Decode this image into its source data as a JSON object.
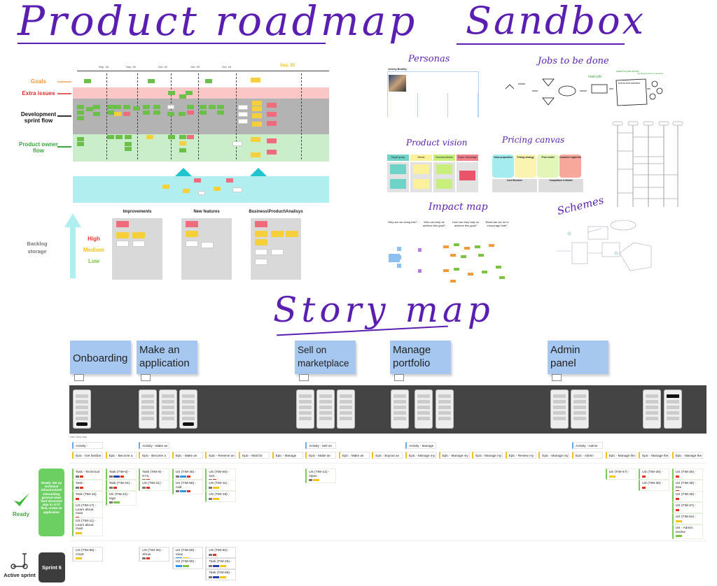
{
  "titles": {
    "roadmap": "Product roadmap",
    "sandbox": "Sandbox",
    "story_map": "Story map"
  },
  "roadmap": {
    "dates": [
      "Sep. 18",
      "Sep. 25",
      "Oct. 02",
      "Oct. 09",
      "Oct. 16",
      "Sep. 25"
    ],
    "highlight_color": "#f5c518",
    "rows": {
      "goals": {
        "label": "Goals",
        "color": "#f39a3a"
      },
      "extra": {
        "label": "Extra issues",
        "color": "#e02a2a"
      },
      "dev": {
        "label": "Development sprint flow",
        "color": "#111111"
      },
      "po": {
        "label": "Product owner flow",
        "color": "#3aa53a"
      }
    },
    "band_colors": {
      "extra": "#fbc6c6",
      "dev": "#b3b3b3",
      "po": "#c9eec9",
      "backlog": "#b1eef0"
    },
    "backlog": {
      "label": "Backlog storage",
      "priorities": [
        {
          "label": "High",
          "color": "#e53333"
        },
        {
          "label": "Medium",
          "color": "#f3c21b"
        },
        {
          "label": "Low",
          "color": "#7dc243"
        }
      ],
      "columns": [
        "Improvements",
        "New features",
        "Business\\Product\\Analisys"
      ]
    }
  },
  "sandbox": {
    "sections": [
      "Personas",
      "Jobs to be done",
      "Product vision",
      "Pricing canvas",
      "Impact map",
      "Schemes"
    ],
    "persona_name": "Jeremy Bradley",
    "jtbd_notes": [
      "main job",
      "end-to-end scenario",
      "assist for jobs stories",
      "hypothesis about motivation"
    ],
    "vision_headers": [
      "Target group",
      "Needs",
      "Success factors",
      "Super advantage"
    ],
    "pricing_blocks": [
      "Value proposition",
      "Pricing strategy",
      "Price model",
      "Customer segments",
      "Cost Structure",
      "Competitors & Market"
    ],
    "impact_questions": [
      "Why are we doing this?",
      "Who can help us achieve this goal?",
      "How can they help us achieve this goal?",
      "What can we do to encourage that?"
    ]
  },
  "story_map": {
    "activities": [
      "Onboarding",
      "Make an application",
      "Sell on marketplace",
      "Manage portfolio",
      "Admin panel"
    ],
    "caption": "User Story Map",
    "activity_cards": [
      {
        "col": 0,
        "label": "Activity -"
      },
      {
        "col": 2,
        "label": "Activity - Make an"
      },
      {
        "col": 7,
        "label": "Activity - Sell on"
      },
      {
        "col": 10,
        "label": "Activity - Manage"
      },
      {
        "col": 15,
        "label": "Activity - Admin"
      }
    ],
    "epics": [
      "Epic - Get familiar",
      "Epic - Become a",
      "Epic - Become a",
      "Epic - Make an",
      "Epic - Reserve an",
      "Epic - Wait for",
      "Epic - Manage",
      "Epic - Make an",
      "Epic - Make an",
      "Epic - Buyout an",
      "Epic - Manage my",
      "Epic - Manage my",
      "Epic - Manage my",
      "Epic - Review my",
      "Epic - Manage my",
      "Epic - Admin",
      "Epic - Manage the",
      "Epic - Manage the",
      "Epic - Manage the"
    ],
    "ready": {
      "label": "Ready",
      "description": "Ready: Set up technical infrastructure/ onboarding, general news feed structure/ sign in, KYC flow, create an application",
      "color": "#6ccf62",
      "cards": [
        {
          "col": 0,
          "items": [
            {
              "t": "Task - Technical",
              "tags": [
                "g",
                "r"
              ]
            },
            {
              "t": "Task -",
              "tags": [
                "g",
                "r"
              ]
            },
            {
              "t": "Task (TIM-15)",
              "tags": [
                "r"
              ]
            },
            {
              "t": "US (TIM-17) - Learn about main",
              "tags": [
                "r"
              ]
            },
            {
              "t": "US (TIM-11) - Learn about main",
              "tags": [
                "y"
              ]
            }
          ]
        },
        {
          "col": 1,
          "items": [
            {
              "t": "Task (TIM-6) -",
              "tags": [
                "g",
                "b",
                "r"
              ]
            },
            {
              "t": "Task (TIM-24) -",
              "tags": [
                "g",
                "r"
              ]
            },
            {
              "t": "US (TIM-22) - Sign",
              "tags": [
                "g",
                "gr"
              ]
            }
          ]
        },
        {
          "col": 2,
          "items": [
            {
              "t": "Task (TIM-9) - KYC",
              "tags": [
                "g",
                "r"
              ]
            },
            {
              "t": "US (TIM-21) -",
              "tags": [
                "g",
                "r"
              ]
            }
          ]
        },
        {
          "col": 3,
          "items": [
            {
              "t": "US (TIM-46) -",
              "tags": [
                "g",
                "l",
                "r"
              ]
            },
            {
              "t": "US (TIM-58) - Add",
              "tags": [
                "g",
                "l",
                "r"
              ]
            }
          ]
        },
        {
          "col": 4,
          "items": [
            {
              "t": "US (TIM-50) - Get",
              "tags": [
                "g",
                "r"
              ]
            },
            {
              "t": "US (TIM-11) -",
              "tags": [
                "g",
                "y"
              ]
            },
            {
              "t": "US (TIM-19) -",
              "tags": [
                "g",
                "y"
              ]
            }
          ]
        },
        {
          "col": 7,
          "items": [
            {
              "t": "US (TIM-12) - Open",
              "tags": [
                "g",
                "y"
              ]
            }
          ]
        },
        {
          "col": 16,
          "items": [
            {
              "t": "US (TIM-47) -",
              "tags": [
                "y"
              ]
            }
          ]
        },
        {
          "col": 17,
          "items": [
            {
              "t": "US (TIM-28) -",
              "tags": [
                "r"
              ]
            },
            {
              "t": "US (TIM-30) -",
              "tags": [
                "r"
              ]
            }
          ]
        },
        {
          "col": 18,
          "items": [
            {
              "t": "US (TIM-25) -",
              "tags": [
                "r"
              ]
            },
            {
              "t": "US (TIM-38) - See",
              "tags": [
                "r"
              ]
            },
            {
              "t": "US (TIM-29) -",
              "tags": [
                "r"
              ]
            },
            {
              "t": "US (TIM-27) -",
              "tags": [
                "r"
              ]
            },
            {
              "t": "US (TIM-54) -",
              "tags": [
                "y"
              ]
            },
            {
              "t": "US - Admin: review",
              "tags": [
                "gr"
              ]
            }
          ]
        }
      ]
    },
    "sprint": {
      "label": "Active sprint",
      "name": "Sprint 6",
      "color": "#3c3c3c",
      "cards": [
        {
          "col": 0,
          "items": [
            {
              "t": "US (TIM-86) - Chart",
              "tags": [
                "y"
              ]
            }
          ]
        },
        {
          "col": 2,
          "items": [
            {
              "t": "US (TIM-36) - Show",
              "tags": [
                "g",
                "r"
              ]
            }
          ]
        },
        {
          "col": 3,
          "items": [
            {
              "t": "US (TIM-69) - View",
              "tags": [
                "l",
                "y"
              ]
            },
            {
              "t": "US (TIM-90) -",
              "tags": [
                "l",
                "gr"
              ]
            }
          ]
        },
        {
          "col": 4,
          "items": [
            {
              "t": "US (TIM-82) -",
              "tags": [
                "g",
                "r"
              ]
            },
            {
              "t": "Task (TIM-45) -",
              "tags": [
                "g",
                "b",
                "y"
              ]
            },
            {
              "t": "Task (TIM-85) -",
              "tags": [
                "g",
                "b",
                "y"
              ]
            }
          ]
        }
      ]
    },
    "tag_colors": {
      "g": "#777777",
      "r": "#e0301e",
      "b": "#233fa8",
      "l": "#2b95e8",
      "y": "#f5c518",
      "gr": "#7dc243"
    }
  }
}
